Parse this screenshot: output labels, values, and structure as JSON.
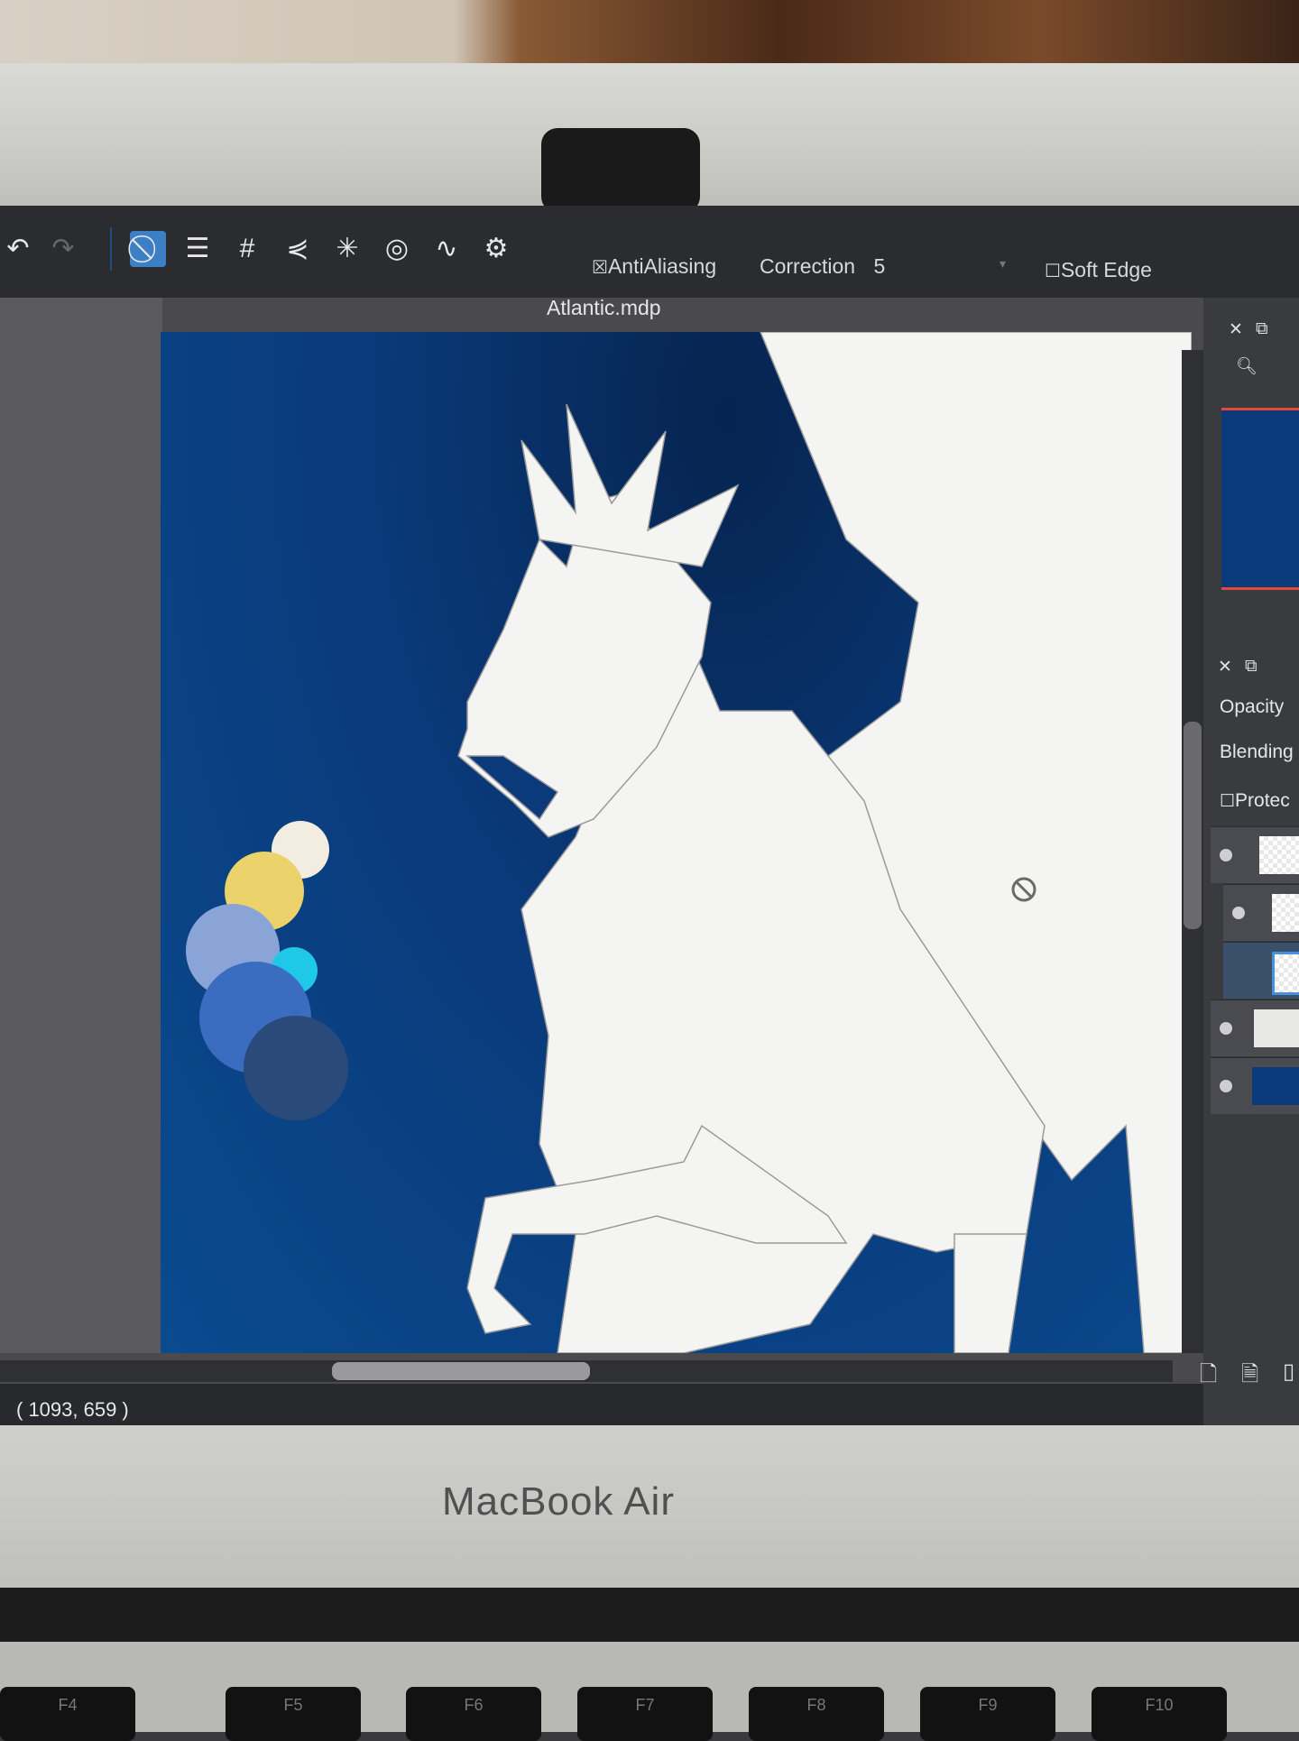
{
  "toolbar": {
    "antialiasing_label": "AntiAliasing",
    "antialiasing_checked": true,
    "correction_label": "Correction",
    "correction_value": "5",
    "soft_edge_label": "Soft Edge",
    "soft_edge_checked": false
  },
  "document": {
    "title": "Atlantic.mdp"
  },
  "status": {
    "coords": "( 1093, 659 )"
  },
  "right_panel": {
    "opacity_label": "Opacity",
    "blending_label": "Blending",
    "protect_label": "Protec"
  },
  "palette_colors": [
    "#f2ede0",
    "#ecd26a",
    "#8aa4d8",
    "#20c8e8",
    "#3a6cc0",
    "#2a4a7a"
  ],
  "canvas_colors": {
    "background": "#0a3a7a",
    "line_art": "#f4f4f2"
  },
  "laptop": {
    "brand": "MacBook Air"
  },
  "keys": [
    "F4",
    "F5",
    "F6",
    "F7",
    "F8",
    "F9",
    "F10"
  ]
}
